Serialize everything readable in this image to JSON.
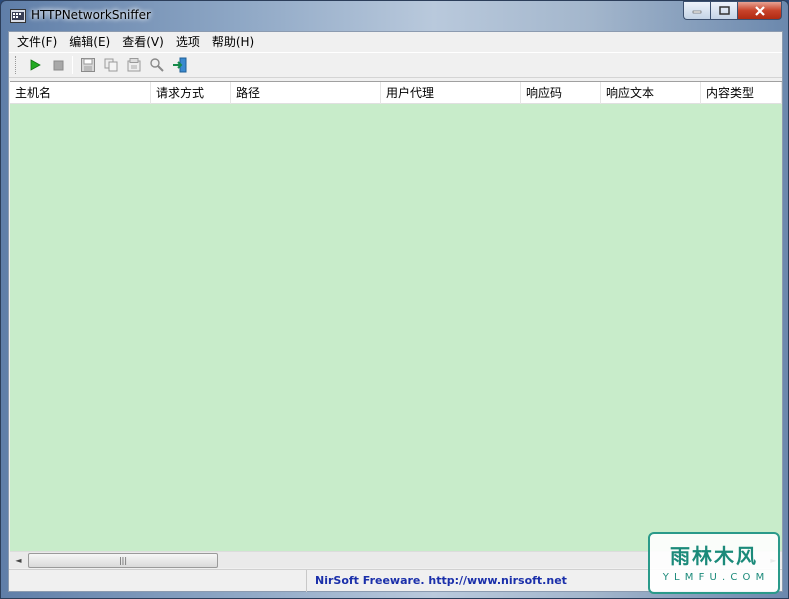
{
  "window": {
    "title": "HTTPNetworkSniffer",
    "icon": "app-icon"
  },
  "menu": {
    "items": [
      "文件(F)",
      "编辑(E)",
      "查看(V)",
      "选项",
      "帮助(H)"
    ]
  },
  "toolbar": {
    "buttons": [
      "start-icon",
      "stop-icon",
      "save-icon",
      "copy-icon",
      "properties-icon",
      "find-icon",
      "exit-icon"
    ]
  },
  "list": {
    "columns": [
      "主机名",
      "请求方式",
      "路径",
      "用户代理",
      "响应码",
      "响应文本",
      "内容类型"
    ],
    "background_color": "#c8ecca"
  },
  "status": {
    "link_text": "NirSoft Freeware.  http://www.nirsoft.net"
  },
  "watermark": {
    "title": "雨林木风",
    "subtitle": "Y L M F U . C O M"
  }
}
